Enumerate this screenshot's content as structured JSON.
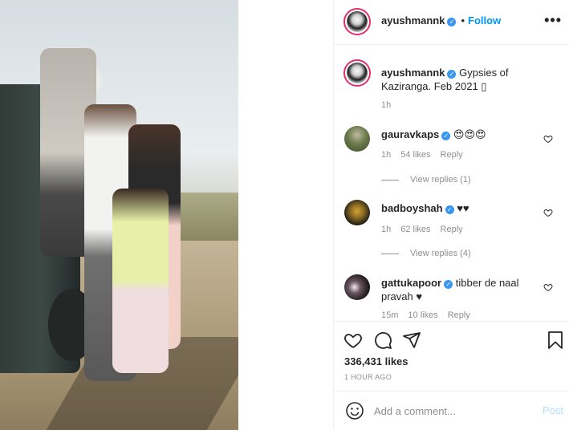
{
  "post": {
    "username": "ayushmannk",
    "follow_label": "Follow",
    "separator": "•",
    "more_label": "•••",
    "verified_glyph": "✓"
  },
  "caption": {
    "username": "ayushmannk",
    "text": "Gypsies of Kaziranga. Feb 2021 ▯",
    "time": "1h"
  },
  "comments": [
    {
      "username": "gauravkaps",
      "text": "😍😍😍",
      "time": "1h",
      "likes": "54 likes",
      "reply": "Reply",
      "view_replies": "View replies (1)",
      "avatar_color": "#4f5a3c"
    },
    {
      "username": "badboyshah",
      "text": "♥♥",
      "time": "1h",
      "likes": "62 likes",
      "reply": "Reply",
      "view_replies": "View replies (4)",
      "avatar_color": "#2c2a20"
    },
    {
      "username": "gattukapoor",
      "text": "tibber de naal pravah ♥",
      "time": "15m",
      "likes": "10 likes",
      "reply": "Reply",
      "avatar_color": "#3a2b33"
    }
  ],
  "actions": {
    "likes": "336,431 likes",
    "time": "1 HOUR AGO"
  },
  "add_comment": {
    "placeholder": "Add a comment...",
    "post_label": "Post"
  },
  "colors": {
    "accent": "#0095f6",
    "verified": "#3897f0",
    "muted": "#8e8e8e",
    "post_disabled": "#b2dffc"
  },
  "icons": {
    "heart": "heart-icon",
    "comment": "comment-icon",
    "share": "share-icon",
    "save": "bookmark-icon",
    "emoji": "emoji-icon",
    "more": "more-icon"
  }
}
